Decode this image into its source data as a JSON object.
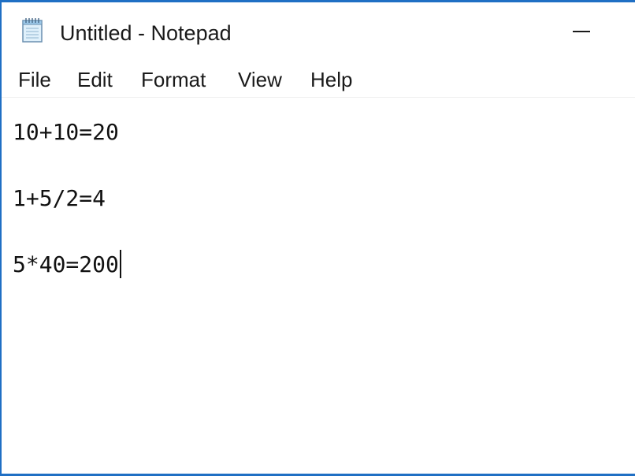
{
  "window": {
    "title": "Untitled - Notepad",
    "app_icon": "notepad-icon",
    "minimize_icon": "minimize-icon"
  },
  "menubar": {
    "items": [
      {
        "label": "File"
      },
      {
        "label": "Edit"
      },
      {
        "label": "Format"
      },
      {
        "label": "View"
      },
      {
        "label": "Help"
      }
    ]
  },
  "editor": {
    "lines": [
      "10+10=20",
      "1+5/2=4",
      "5*40=200"
    ]
  },
  "colors": {
    "window_border": "#1f6fc4",
    "background": "#ffffff",
    "text": "#111111"
  }
}
